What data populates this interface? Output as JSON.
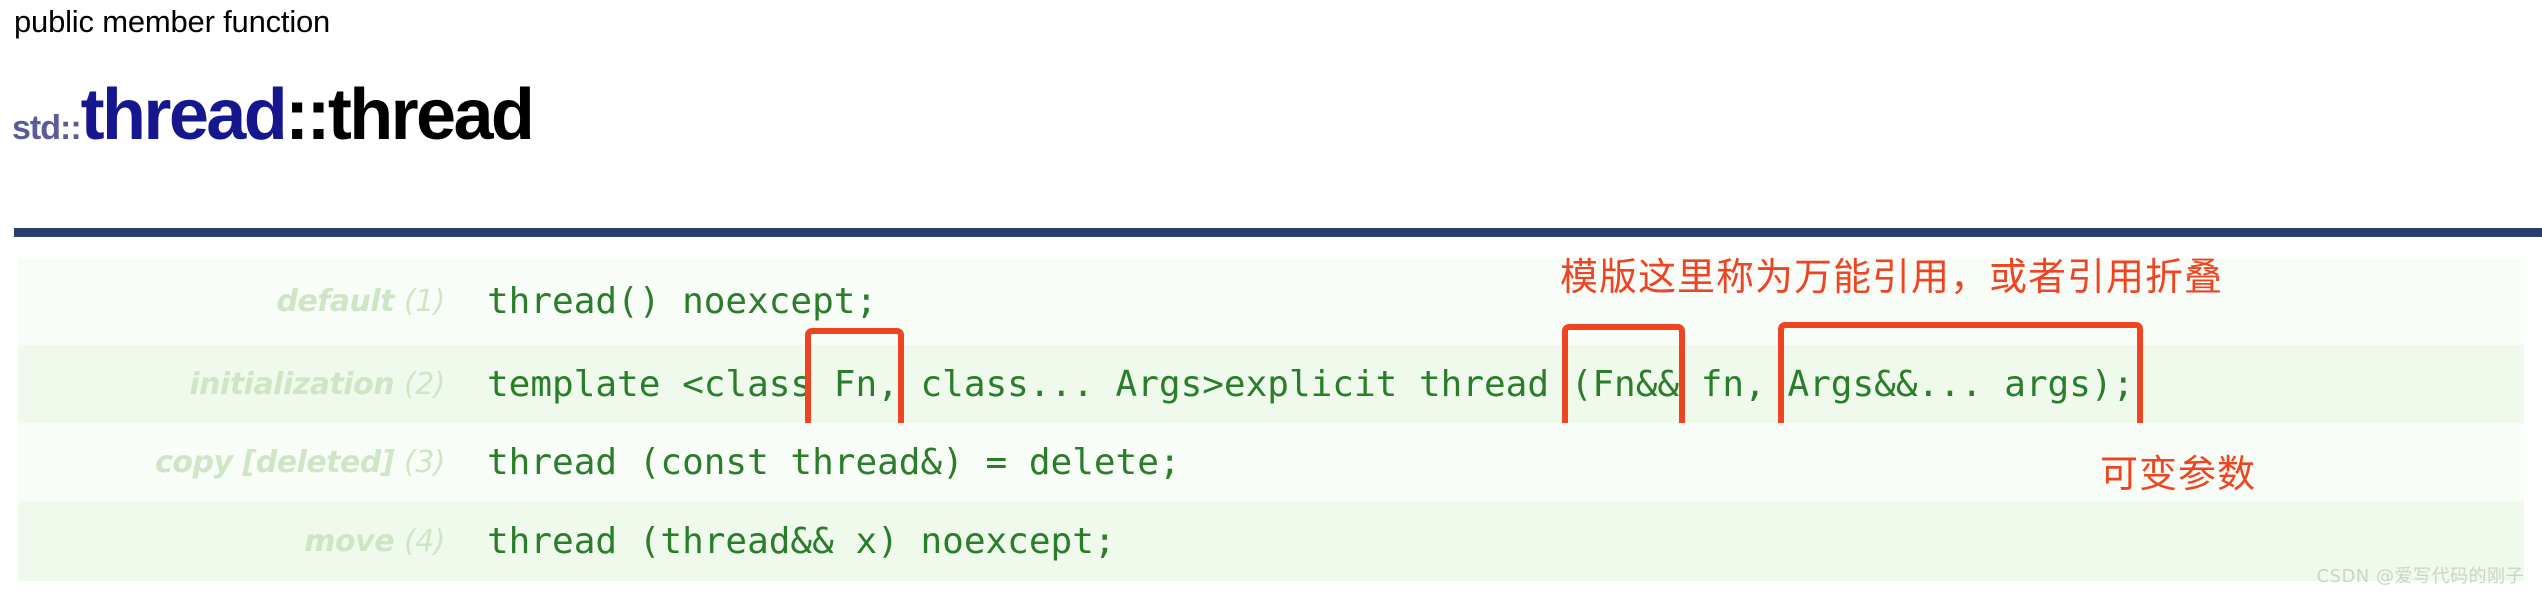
{
  "page": {
    "eyebrow": "public member function",
    "watermark": "CSDN @爱写代码的刚子"
  },
  "title": {
    "namespace": "std::",
    "class_name": "thread",
    "separator_and_function": "::thread",
    "namespace_color": "#5b5b9c",
    "class_color": "#16168e",
    "function_color": "#000000"
  },
  "divider": {
    "color": "#2b3f6e"
  },
  "signatures": {
    "rows": [
      {
        "label": "default",
        "number": "(1)",
        "code_parts": [
          {
            "text": "thread() noexcept;",
            "highlight": false
          }
        ]
      },
      {
        "label": "initialization",
        "number": "(2)",
        "code_parts": [
          {
            "text": "template <class",
            "highlight": false
          },
          {
            "text": " Fn,",
            "highlight": true,
            "box": "b-fn"
          },
          {
            "text": " class... Args>explicit thread ",
            "highlight": false
          },
          {
            "text": "(Fn&&",
            "highlight": true,
            "box": "b-fnref"
          },
          {
            "text": " fn, ",
            "highlight": false
          },
          {
            "text": "Args&&... args);",
            "highlight": true,
            "box": "b-args"
          }
        ]
      },
      {
        "label": "copy [deleted]",
        "number": "(3)",
        "code_parts": [
          {
            "text": "thread (const thread&) = delete;",
            "highlight": false
          }
        ]
      },
      {
        "label": "move",
        "number": "(4)",
        "code_parts": [
          {
            "text": "thread (thread&& x) noexcept;",
            "highlight": false
          }
        ]
      }
    ],
    "code_color": "#2a7d2a",
    "label_color": "#cfe6c6",
    "row_bg_odd": "#f9fdf7",
    "row_bg_even": "#eff9ec",
    "highlight_box_color": "#ef4422"
  },
  "annotations": {
    "top": "模版这里称为万能引用，或者引用折叠",
    "bottom": "可变参数",
    "color": "#ef4422"
  }
}
